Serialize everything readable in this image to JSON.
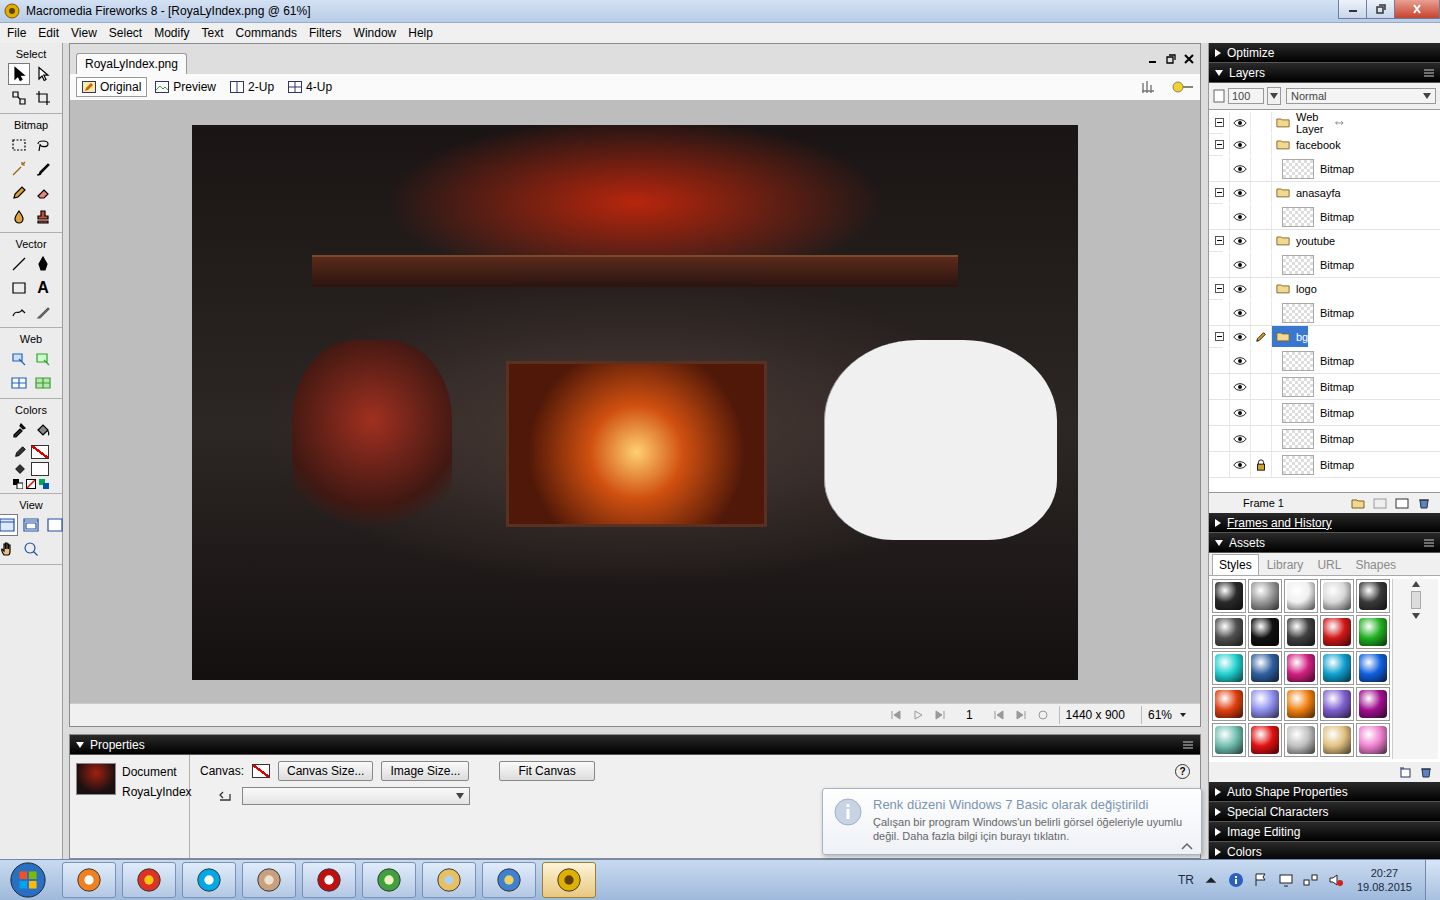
{
  "window": {
    "title": "Macromedia Fireworks 8 - [RoyaLyIndex.png @ 61%]"
  },
  "menu": [
    "File",
    "Edit",
    "View",
    "Select",
    "Modify",
    "Text",
    "Commands",
    "Filters",
    "Window",
    "Help"
  ],
  "toolbar": [
    {
      "label": "Select",
      "tools": [
        {
          "selected": true
        },
        {
          "selected": false
        },
        {
          "selected": false
        },
        {
          "selected": false
        }
      ]
    },
    {
      "label": "Bitmap",
      "tools": [
        {
          "selected": false
        },
        {
          "selected": false
        },
        {
          "selected": false
        },
        {
          "selected": false
        },
        {
          "selected": false
        },
        {
          "selected": false
        },
        {
          "selected": false
        },
        {
          "selected": false
        }
      ]
    },
    {
      "label": "Vector",
      "tools": [
        {
          "selected": false
        },
        {
          "selected": false
        },
        {
          "selected": false
        },
        {
          "selected": false,
          "glyph": "A"
        },
        {
          "selected": false
        },
        {
          "selected": false
        }
      ]
    },
    {
      "label": "Web",
      "tools": [
        {
          "selected": false
        },
        {
          "selected": false
        },
        {
          "selected": false
        },
        {
          "selected": false
        }
      ]
    },
    {
      "label": "Colors",
      "tools": [
        {
          "selected": false
        },
        {
          "selected": false
        }
      ],
      "stroke_none": true,
      "fill": "#ffffff"
    },
    {
      "label": "View",
      "tools": [
        {
          "selected": true
        },
        {
          "selected": false
        },
        {
          "selected": false
        },
        {
          "selected": false
        },
        {
          "selected": false
        }
      ]
    }
  ],
  "document": {
    "tab": "RoyaLyIndex.png",
    "views": [
      {
        "label": "Original",
        "selected": true
      },
      {
        "label": "Preview",
        "selected": false
      },
      {
        "label": "2-Up",
        "selected": false
      },
      {
        "label": "4-Up",
        "selected": false
      }
    ],
    "frame": "1",
    "size": "1440 x 900",
    "zoom": "61%"
  },
  "properties": {
    "header": "Properties",
    "type": "Document",
    "name": "RoyaLyIndex",
    "canvas_label": "Canvas:",
    "buttons": [
      "Canvas Size...",
      "Image Size...",
      "Fit Canvas"
    ],
    "help": "?"
  },
  "optimize": {
    "label": "Optimize",
    "expanded": false
  },
  "layers": {
    "label": "Layers",
    "expanded": true,
    "opacity": "100",
    "blend": "Normal",
    "frame": "Frame 1",
    "items": [
      {
        "name": "Web Layer",
        "kind": "folder",
        "expanded": true,
        "visible": true,
        "selected": false,
        "locked": false,
        "editing": false
      },
      {
        "name": "facebook",
        "kind": "folder",
        "expanded": true,
        "visible": true,
        "selected": false,
        "locked": false,
        "editing": false
      },
      {
        "name": "Bitmap",
        "kind": "object",
        "expanded": false,
        "visible": true,
        "selected": false,
        "locked": false,
        "editing": false
      },
      {
        "name": "anasayfa",
        "kind": "folder",
        "expanded": true,
        "visible": true,
        "selected": false,
        "locked": false,
        "editing": false
      },
      {
        "name": "Bitmap",
        "kind": "object",
        "expanded": false,
        "visible": true,
        "selected": false,
        "locked": false,
        "editing": false
      },
      {
        "name": "youtube",
        "kind": "folder",
        "expanded": true,
        "visible": true,
        "selected": false,
        "locked": false,
        "editing": false
      },
      {
        "name": "Bitmap",
        "kind": "object",
        "expanded": false,
        "visible": true,
        "selected": false,
        "locked": false,
        "editing": false
      },
      {
        "name": "logo",
        "kind": "folder",
        "expanded": true,
        "visible": true,
        "selected": false,
        "locked": false,
        "editing": false
      },
      {
        "name": "Bitmap",
        "kind": "object",
        "expanded": false,
        "visible": true,
        "selected": false,
        "locked": false,
        "editing": false
      },
      {
        "name": "bg",
        "kind": "folder",
        "expanded": true,
        "visible": true,
        "selected": true,
        "locked": false,
        "editing": true
      },
      {
        "name": "Bitmap",
        "kind": "object",
        "expanded": false,
        "visible": true,
        "selected": false,
        "locked": false,
        "editing": false
      },
      {
        "name": "Bitmap",
        "kind": "object",
        "expanded": false,
        "visible": true,
        "selected": false,
        "locked": false,
        "editing": false
      },
      {
        "name": "Bitmap",
        "kind": "object",
        "expanded": false,
        "visible": true,
        "selected": false,
        "locked": false,
        "editing": false
      },
      {
        "name": "Bitmap",
        "kind": "object",
        "expanded": false,
        "visible": true,
        "selected": false,
        "locked": false,
        "editing": false
      },
      {
        "name": "Bitmap",
        "kind": "object",
        "expanded": false,
        "visible": true,
        "selected": false,
        "locked": true,
        "editing": false
      }
    ]
  },
  "frames_history": {
    "label": "Frames and History",
    "expanded": false
  },
  "assets": {
    "label": "Assets",
    "expanded": true,
    "tabs": [
      {
        "label": "Styles",
        "selected": true
      },
      {
        "label": "Library",
        "selected": false
      },
      {
        "label": "URL",
        "selected": false
      },
      {
        "label": "Shapes",
        "selected": false
      }
    ],
    "styles": [
      {
        "color": "#2a2a2a"
      },
      {
        "color": "#9a9a9a"
      },
      {
        "color": "#f0f0f0"
      },
      {
        "color": "#d8d8d8"
      },
      {
        "color": "#3a3a3a"
      },
      {
        "color": "#505050"
      },
      {
        "color": "#111111"
      },
      {
        "color": "#404040"
      },
      {
        "color": "#d01818"
      },
      {
        "color": "#20b020"
      },
      {
        "color": "#20d0d0"
      },
      {
        "color": "#3060a0"
      },
      {
        "color": "#d02080"
      },
      {
        "color": "#10a0d0"
      },
      {
        "color": "#1060e0"
      },
      {
        "color": "#e04010"
      },
      {
        "color": "#9090f0"
      },
      {
        "color": "#f08010"
      },
      {
        "color": "#8060d0"
      },
      {
        "color": "#a01090"
      },
      {
        "color": "#70c0b0"
      },
      {
        "color": "#e01010"
      },
      {
        "color": "#c0c0c0"
      },
      {
        "color": "#e0c080"
      },
      {
        "color": "#f080d0"
      }
    ]
  },
  "bottom_panels": [
    {
      "label": "Auto Shape Properties",
      "expanded": false
    },
    {
      "label": "Special Characters",
      "expanded": false
    },
    {
      "label": "Image Editing",
      "expanded": false
    },
    {
      "label": "Colors",
      "expanded": false
    }
  ],
  "notification": {
    "title": "Renk düzeni Windows 7 Basic olarak değiştirildi",
    "body": "Çalışan bir program Windows'un belirli görsel öğeleriyle uyumlu değil. Daha fazla bilgi için burayı tıklatın."
  },
  "taskbar": {
    "apps": [
      {
        "selected": false
      },
      {
        "selected": false
      },
      {
        "selected": false
      },
      {
        "selected": false
      },
      {
        "selected": false
      },
      {
        "selected": false
      },
      {
        "selected": false
      },
      {
        "selected": false
      },
      {
        "selected": true
      }
    ],
    "language": "TR",
    "time": "20:27",
    "date": "19.08.2015"
  }
}
